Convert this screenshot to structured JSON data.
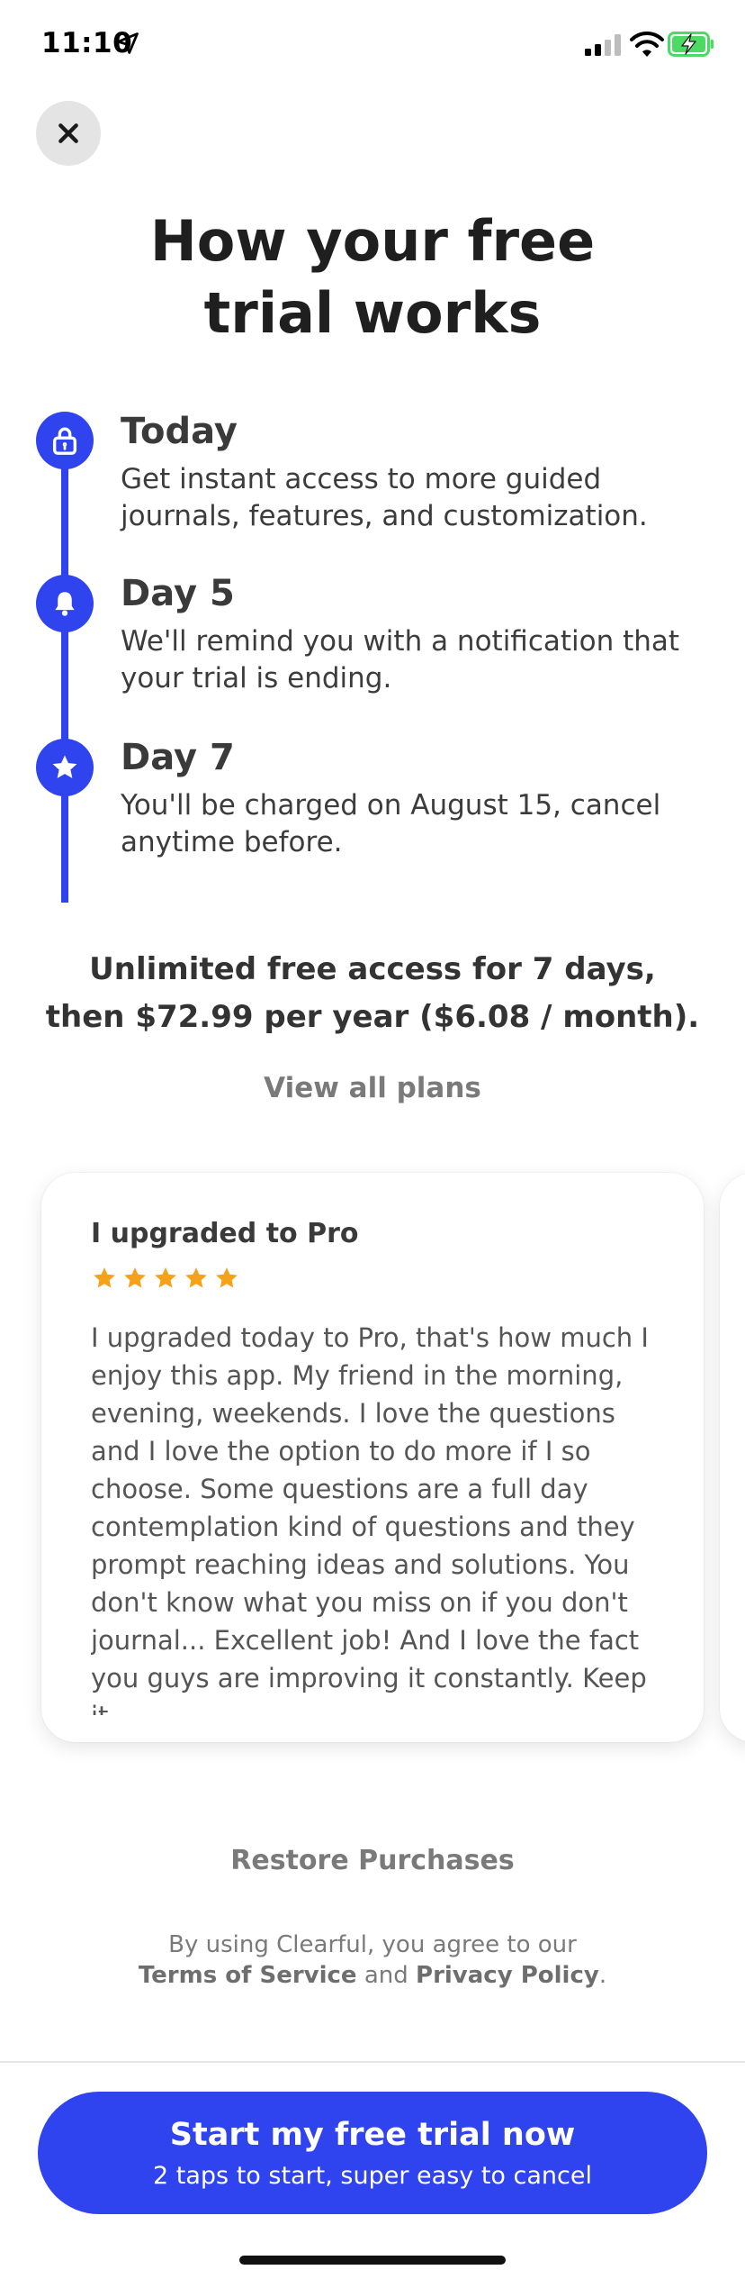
{
  "status_bar": {
    "time": "11:10",
    "icons": [
      "location-arrow-icon",
      "signal-icon",
      "wifi-icon",
      "battery-charging-icon"
    ]
  },
  "header": {
    "close_icon": "close-icon",
    "title": "How your free\ntrial works"
  },
  "timeline": {
    "accent": "#2f43ef",
    "steps": [
      {
        "icon": "unlock-icon",
        "title": "Today",
        "description": "Get instant access to more guided journals, features, and customization."
      },
      {
        "icon": "bell-icon",
        "title": "Day 5",
        "description": "We'll remind you with a notification that your trial is ending."
      },
      {
        "icon": "star-icon",
        "title": "Day 7",
        "description": "You'll be charged on August 15, cancel anytime before."
      }
    ]
  },
  "pricing": {
    "line1": "Unlimited free access for 7 days,",
    "line2": "then $72.99 per year ($6.08 / month)."
  },
  "view_plans_label": "View all plans",
  "review": {
    "title": "I upgraded to Pro",
    "rating": 5,
    "star_color": "#f5a11a",
    "body": "I upgraded today to Pro, that's how much I enjoy this app. My friend in the morning, evening, weekends. I love the questions and I love the option to do more if I so choose. Some questions are a full day contemplation kind of questions and they prompt reaching ideas and solutions. You don't know what you miss on if you don't journal... Excellent job! And I love the fact you guys are improving it constantly. Keep it"
  },
  "footer": {
    "restore_label": "Restore Purchases",
    "legal_prefix": "By using Clearful, you agree to our",
    "terms_label": "Terms of Service",
    "and_text": "and",
    "privacy_label": "Privacy Policy",
    "period": "."
  },
  "cta": {
    "title": "Start my free trial now",
    "subtitle": "2 taps to start, super easy to cancel",
    "color": "#2f43ef"
  }
}
